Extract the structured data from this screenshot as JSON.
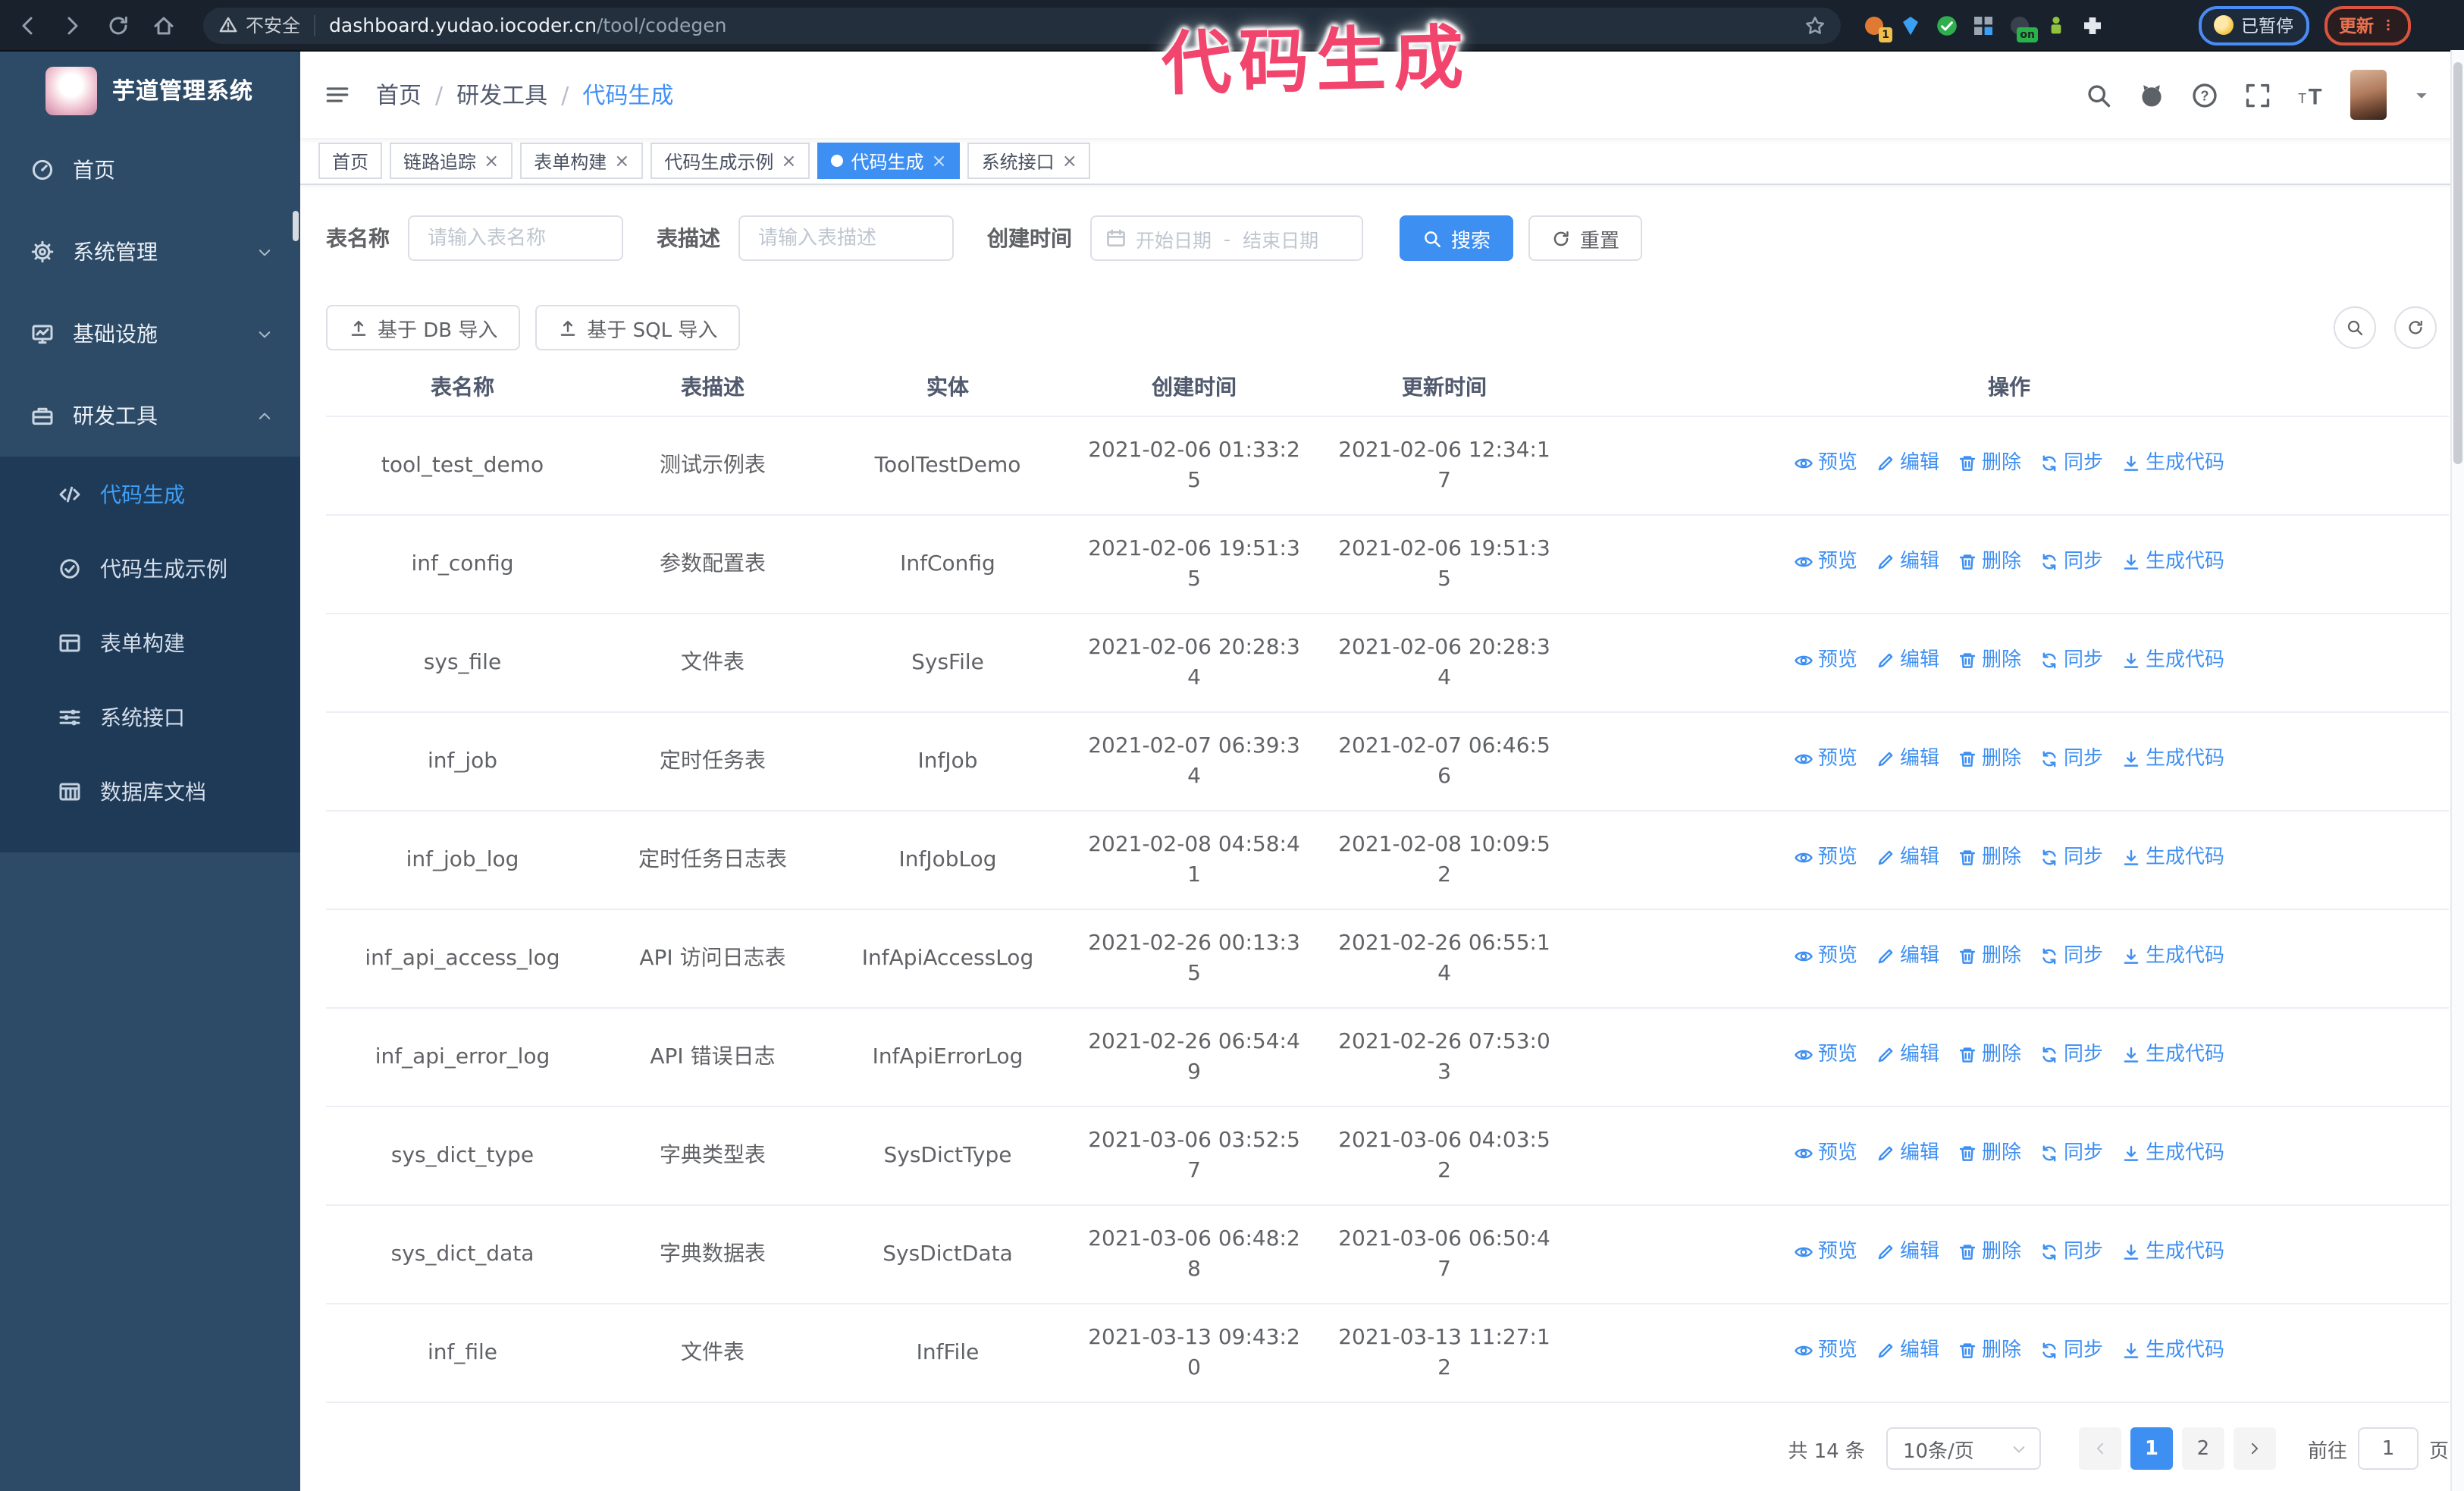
{
  "colors": {
    "accent": "#3e8ff2",
    "sidebar_bg": "#2d4b67",
    "submenu_bg": "#1e3a57",
    "annotation_pink": "#f2456d",
    "tag_active_bg": "#3e8ff2",
    "update_button_orange": "#e8714f",
    "paused_pill_blue": "#4a8cf5"
  },
  "browser": {
    "security_label": "不安全",
    "url_host": "dashboard.yudao.iocoder.cn",
    "url_path": "/tool/codegen",
    "paused_badge": "已暂停",
    "update_button": "更新",
    "extensions": [
      {
        "name": "orange-extension-icon",
        "icon": "circle",
        "color": "#e07a33",
        "badge": "1",
        "badge_color": "#f1bf4b"
      },
      {
        "name": "gem-extension-icon",
        "icon": "gem",
        "color": "#39a0f4"
      },
      {
        "name": "check-extension-icon",
        "icon": "check-circle",
        "color": "#2fae4e"
      },
      {
        "name": "grid-extension-icon",
        "icon": "grid",
        "color": "#9aa6b4"
      },
      {
        "name": "on-badge-extension-icon",
        "icon": "circle",
        "color": "#39414d",
        "badge": "on",
        "badge_color": "#28b24a"
      },
      {
        "name": "robot-extension-icon",
        "icon": "robot",
        "color": "#8fc43c"
      },
      {
        "name": "puzzle-extension-icon",
        "icon": "puzzle",
        "color": "#e3e8ee"
      }
    ]
  },
  "annotation": {
    "text": "代码生成"
  },
  "sidebar": {
    "logo_title": "芋道管理系统",
    "menu": [
      {
        "id": "home",
        "label": "首页",
        "icon": "dashboard"
      },
      {
        "id": "system",
        "label": "系统管理",
        "icon": "gear",
        "arrow": "chevron-down"
      },
      {
        "id": "infra",
        "label": "基础设施",
        "icon": "monitor",
        "arrow": "chevron-down"
      },
      {
        "id": "devtools",
        "label": "研发工具",
        "icon": "toolbox",
        "arrow": "chevron-up",
        "children": [
          {
            "id": "codegen",
            "label": "代码生成",
            "icon": "code",
            "active": true
          },
          {
            "id": "codegen-example",
            "label": "代码生成示例",
            "icon": "badge"
          },
          {
            "id": "form-builder",
            "label": "表单构建",
            "icon": "form"
          },
          {
            "id": "system-api",
            "label": "系统接口",
            "icon": "sliders"
          },
          {
            "id": "db-doc",
            "label": "数据库文档",
            "icon": "database"
          }
        ]
      }
    ]
  },
  "header": {
    "breadcrumb": [
      "首页",
      "研发工具",
      "代码生成"
    ]
  },
  "tags": [
    {
      "id": "home",
      "label": "首页",
      "closable": false
    },
    {
      "id": "tracing",
      "label": "链路追踪",
      "closable": true
    },
    {
      "id": "form-builder",
      "label": "表单构建",
      "closable": true
    },
    {
      "id": "codegen-example",
      "label": "代码生成示例",
      "closable": true
    },
    {
      "id": "codegen",
      "label": "代码生成",
      "closable": true,
      "active": true
    },
    {
      "id": "system-api",
      "label": "系统接口",
      "closable": true
    }
  ],
  "filters": {
    "name_label": "表名称",
    "name_placeholder": "请输入表名称",
    "desc_label": "表描述",
    "desc_placeholder": "请输入表描述",
    "time_label": "创建时间",
    "start_placeholder": "开始日期",
    "range_separator": "-",
    "end_placeholder": "结束日期",
    "search_label": "搜索",
    "reset_label": "重置"
  },
  "toolbar": {
    "import_db_label": "基于 DB 导入",
    "import_sql_label": "基于 SQL 导入"
  },
  "table": {
    "columns": [
      {
        "id": "name",
        "label": "表名称"
      },
      {
        "id": "desc",
        "label": "表描述"
      },
      {
        "id": "entity",
        "label": "实体"
      },
      {
        "id": "created",
        "label": "创建时间"
      },
      {
        "id": "updated",
        "label": "更新时间"
      },
      {
        "id": "actions",
        "label": "操作"
      }
    ],
    "row_actions": [
      {
        "id": "preview",
        "label": "预览",
        "icon": "eye"
      },
      {
        "id": "edit",
        "label": "编辑",
        "icon": "pencil"
      },
      {
        "id": "delete",
        "label": "删除",
        "icon": "trash"
      },
      {
        "id": "sync",
        "label": "同步",
        "icon": "sync"
      },
      {
        "id": "generate",
        "label": "生成代码",
        "icon": "download"
      }
    ],
    "rows": [
      {
        "name": "tool_test_demo",
        "desc": "测试示例表",
        "entity": "ToolTestDemo",
        "created": "2021-02-06 01:33:25",
        "updated": "2021-02-06 12:34:17"
      },
      {
        "name": "inf_config",
        "desc": "参数配置表",
        "entity": "InfConfig",
        "created": "2021-02-06 19:51:35",
        "updated": "2021-02-06 19:51:35"
      },
      {
        "name": "sys_file",
        "desc": "文件表",
        "entity": "SysFile",
        "created": "2021-02-06 20:28:34",
        "updated": "2021-02-06 20:28:34"
      },
      {
        "name": "inf_job",
        "desc": "定时任务表",
        "entity": "InfJob",
        "created": "2021-02-07 06:39:34",
        "updated": "2021-02-07 06:46:56"
      },
      {
        "name": "inf_job_log",
        "desc": "定时任务日志表",
        "entity": "InfJobLog",
        "created": "2021-02-08 04:58:41",
        "updated": "2021-02-08 10:09:52"
      },
      {
        "name": "inf_api_access_log",
        "desc": "API 访问日志表",
        "entity": "InfApiAccessLog",
        "created": "2021-02-26 00:13:35",
        "updated": "2021-02-26 06:55:14"
      },
      {
        "name": "inf_api_error_log",
        "desc": "API 错误日志",
        "entity": "InfApiErrorLog",
        "created": "2021-02-26 06:54:49",
        "updated": "2021-02-26 07:53:03"
      },
      {
        "name": "sys_dict_type",
        "desc": "字典类型表",
        "entity": "SysDictType",
        "created": "2021-03-06 03:52:57",
        "updated": "2021-03-06 04:03:52"
      },
      {
        "name": "sys_dict_data",
        "desc": "字典数据表",
        "entity": "SysDictData",
        "created": "2021-03-06 06:48:28",
        "updated": "2021-03-06 06:50:47"
      },
      {
        "name": "inf_file",
        "desc": "文件表",
        "entity": "InfFile",
        "created": "2021-03-13 09:43:20",
        "updated": "2021-03-13 11:27:12"
      }
    ]
  },
  "pagination": {
    "total_label": "共 14 条",
    "page_size": "10条/页",
    "pages": [
      "1",
      "2"
    ],
    "active_page": "1",
    "goto_label": "前往",
    "goto_value": "1",
    "page_unit": "页"
  }
}
